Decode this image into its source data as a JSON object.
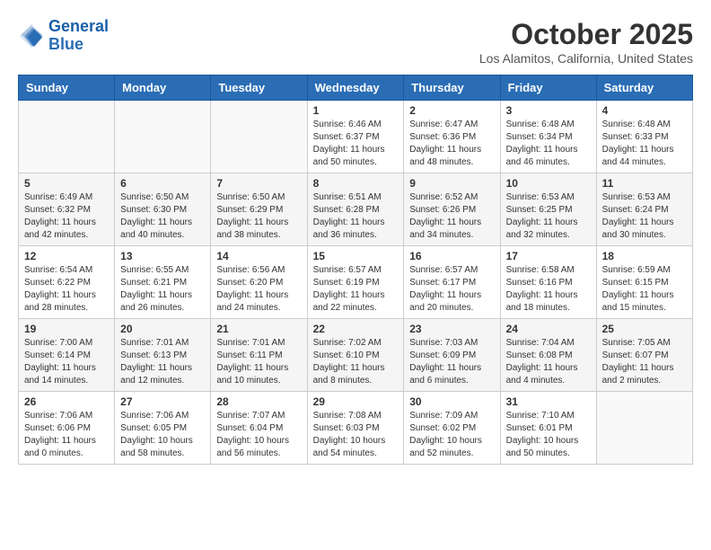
{
  "header": {
    "logo_line1": "General",
    "logo_line2": "Blue",
    "month": "October 2025",
    "location": "Los Alamitos, California, United States"
  },
  "weekdays": [
    "Sunday",
    "Monday",
    "Tuesday",
    "Wednesday",
    "Thursday",
    "Friday",
    "Saturday"
  ],
  "weeks": [
    [
      {
        "day": "",
        "info": ""
      },
      {
        "day": "",
        "info": ""
      },
      {
        "day": "",
        "info": ""
      },
      {
        "day": "1",
        "info": "Sunrise: 6:46 AM\nSunset: 6:37 PM\nDaylight: 11 hours\nand 50 minutes."
      },
      {
        "day": "2",
        "info": "Sunrise: 6:47 AM\nSunset: 6:36 PM\nDaylight: 11 hours\nand 48 minutes."
      },
      {
        "day": "3",
        "info": "Sunrise: 6:48 AM\nSunset: 6:34 PM\nDaylight: 11 hours\nand 46 minutes."
      },
      {
        "day": "4",
        "info": "Sunrise: 6:48 AM\nSunset: 6:33 PM\nDaylight: 11 hours\nand 44 minutes."
      }
    ],
    [
      {
        "day": "5",
        "info": "Sunrise: 6:49 AM\nSunset: 6:32 PM\nDaylight: 11 hours\nand 42 minutes."
      },
      {
        "day": "6",
        "info": "Sunrise: 6:50 AM\nSunset: 6:30 PM\nDaylight: 11 hours\nand 40 minutes."
      },
      {
        "day": "7",
        "info": "Sunrise: 6:50 AM\nSunset: 6:29 PM\nDaylight: 11 hours\nand 38 minutes."
      },
      {
        "day": "8",
        "info": "Sunrise: 6:51 AM\nSunset: 6:28 PM\nDaylight: 11 hours\nand 36 minutes."
      },
      {
        "day": "9",
        "info": "Sunrise: 6:52 AM\nSunset: 6:26 PM\nDaylight: 11 hours\nand 34 minutes."
      },
      {
        "day": "10",
        "info": "Sunrise: 6:53 AM\nSunset: 6:25 PM\nDaylight: 11 hours\nand 32 minutes."
      },
      {
        "day": "11",
        "info": "Sunrise: 6:53 AM\nSunset: 6:24 PM\nDaylight: 11 hours\nand 30 minutes."
      }
    ],
    [
      {
        "day": "12",
        "info": "Sunrise: 6:54 AM\nSunset: 6:22 PM\nDaylight: 11 hours\nand 28 minutes."
      },
      {
        "day": "13",
        "info": "Sunrise: 6:55 AM\nSunset: 6:21 PM\nDaylight: 11 hours\nand 26 minutes."
      },
      {
        "day": "14",
        "info": "Sunrise: 6:56 AM\nSunset: 6:20 PM\nDaylight: 11 hours\nand 24 minutes."
      },
      {
        "day": "15",
        "info": "Sunrise: 6:57 AM\nSunset: 6:19 PM\nDaylight: 11 hours\nand 22 minutes."
      },
      {
        "day": "16",
        "info": "Sunrise: 6:57 AM\nSunset: 6:17 PM\nDaylight: 11 hours\nand 20 minutes."
      },
      {
        "day": "17",
        "info": "Sunrise: 6:58 AM\nSunset: 6:16 PM\nDaylight: 11 hours\nand 18 minutes."
      },
      {
        "day": "18",
        "info": "Sunrise: 6:59 AM\nSunset: 6:15 PM\nDaylight: 11 hours\nand 15 minutes."
      }
    ],
    [
      {
        "day": "19",
        "info": "Sunrise: 7:00 AM\nSunset: 6:14 PM\nDaylight: 11 hours\nand 14 minutes."
      },
      {
        "day": "20",
        "info": "Sunrise: 7:01 AM\nSunset: 6:13 PM\nDaylight: 11 hours\nand 12 minutes."
      },
      {
        "day": "21",
        "info": "Sunrise: 7:01 AM\nSunset: 6:11 PM\nDaylight: 11 hours\nand 10 minutes."
      },
      {
        "day": "22",
        "info": "Sunrise: 7:02 AM\nSunset: 6:10 PM\nDaylight: 11 hours\nand 8 minutes."
      },
      {
        "day": "23",
        "info": "Sunrise: 7:03 AM\nSunset: 6:09 PM\nDaylight: 11 hours\nand 6 minutes."
      },
      {
        "day": "24",
        "info": "Sunrise: 7:04 AM\nSunset: 6:08 PM\nDaylight: 11 hours\nand 4 minutes."
      },
      {
        "day": "25",
        "info": "Sunrise: 7:05 AM\nSunset: 6:07 PM\nDaylight: 11 hours\nand 2 minutes."
      }
    ],
    [
      {
        "day": "26",
        "info": "Sunrise: 7:06 AM\nSunset: 6:06 PM\nDaylight: 11 hours\nand 0 minutes."
      },
      {
        "day": "27",
        "info": "Sunrise: 7:06 AM\nSunset: 6:05 PM\nDaylight: 10 hours\nand 58 minutes."
      },
      {
        "day": "28",
        "info": "Sunrise: 7:07 AM\nSunset: 6:04 PM\nDaylight: 10 hours\nand 56 minutes."
      },
      {
        "day": "29",
        "info": "Sunrise: 7:08 AM\nSunset: 6:03 PM\nDaylight: 10 hours\nand 54 minutes."
      },
      {
        "day": "30",
        "info": "Sunrise: 7:09 AM\nSunset: 6:02 PM\nDaylight: 10 hours\nand 52 minutes."
      },
      {
        "day": "31",
        "info": "Sunrise: 7:10 AM\nSunset: 6:01 PM\nDaylight: 10 hours\nand 50 minutes."
      },
      {
        "day": "",
        "info": ""
      }
    ]
  ]
}
